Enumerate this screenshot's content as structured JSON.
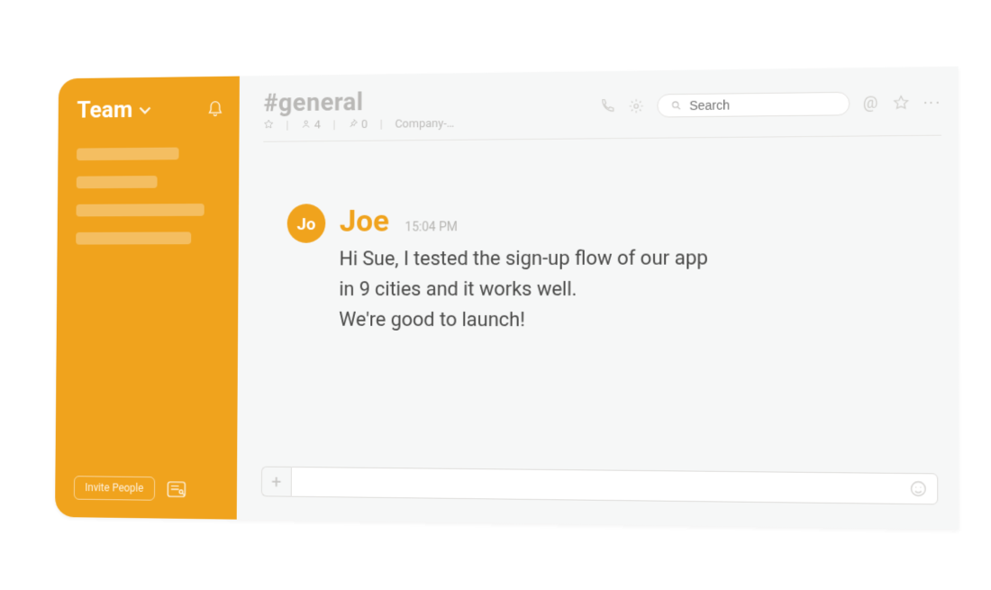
{
  "sidebar": {
    "team_label": "Team",
    "invite_label": "Invite People"
  },
  "header": {
    "channel_name": "#general",
    "members": "4",
    "pins": "0",
    "topic": "Company-…",
    "search_placeholder": "Search"
  },
  "message": {
    "avatar_initials": "Jo",
    "author": "Joe",
    "timestamp": "15:04 PM",
    "line1": "Hi Sue, I tested the sign-up flow of our app",
    "line2": "in 9 cities and it works well.",
    "line3": "We're good to launch!"
  }
}
